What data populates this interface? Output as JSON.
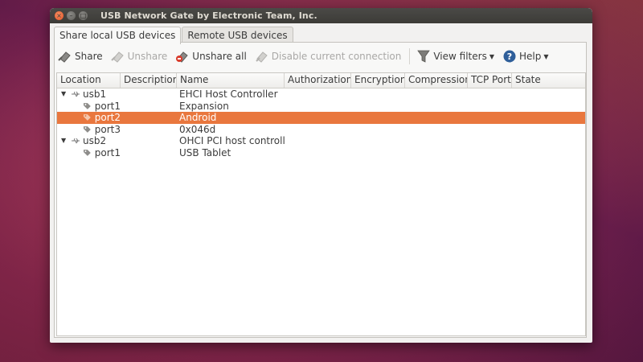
{
  "window": {
    "title": "USB Network Gate by Electronic Team, Inc.",
    "close_glyph": "×",
    "min_glyph": "–",
    "max_glyph": "□"
  },
  "tabs": [
    {
      "label": "Share local USB devices",
      "active": true
    },
    {
      "label": "Remote USB devices",
      "active": false
    }
  ],
  "toolbar": {
    "share": "Share",
    "unshare": "Unshare",
    "unshare_all": "Unshare all",
    "disable_connection": "Disable current connection",
    "view_filters": "View filters",
    "help": "Help"
  },
  "table": {
    "columns": [
      "Location",
      "Description",
      "Name",
      "Authorization",
      "Encryption",
      "Compression",
      "TCP Port",
      "State"
    ],
    "rows": [
      {
        "location": "usb1",
        "name": "EHCI Host Controller",
        "type": "hub"
      },
      {
        "location": "port1",
        "name": "Expansion",
        "type": "port"
      },
      {
        "location": "port2",
        "name": "Android",
        "type": "port",
        "selected": true
      },
      {
        "location": "port3",
        "name": "0x046d",
        "type": "port"
      },
      {
        "location": "usb2",
        "name": "OHCI PCI host controller",
        "type": "hub"
      },
      {
        "location": "port1",
        "name": "USB Tablet",
        "type": "port"
      }
    ]
  },
  "colors": {
    "selection": "#e9773e",
    "titlebar": "#3c3b37"
  }
}
